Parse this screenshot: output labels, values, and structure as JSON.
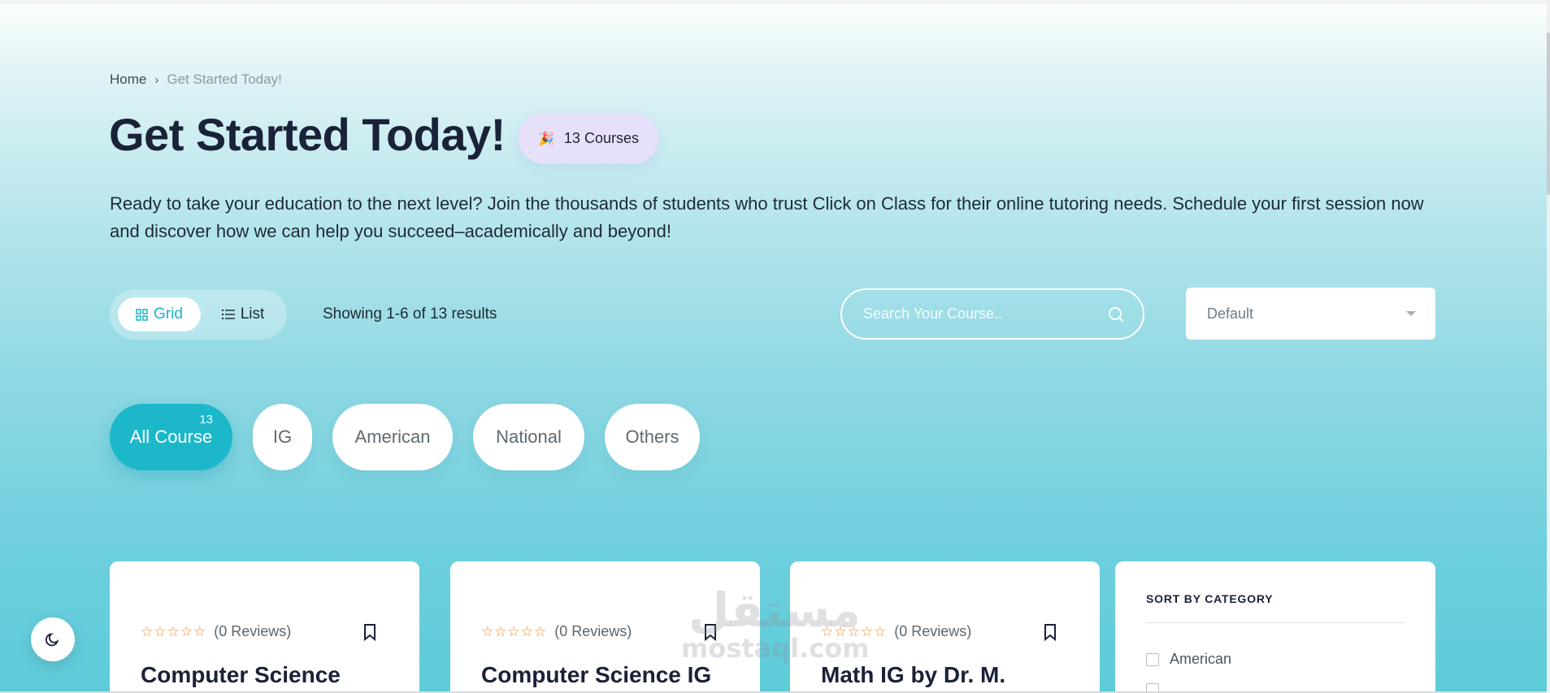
{
  "breadcrumb": {
    "home": "Home",
    "separator": "›",
    "current": "Get Started Today!"
  },
  "header": {
    "title": "Get Started Today!",
    "course_count_icon": "party-popper-icon",
    "course_count": "13 Courses",
    "description": "Ready to take your education to the next level? Join the thousands of students who trust Click on Class for their online tutoring needs. Schedule your first session now and discover how we can help you succeed–academically and beyond!"
  },
  "toolbar": {
    "grid_label": "Grid",
    "list_label": "List",
    "active_view": "Grid",
    "results_text": "Showing 1-6 of 13 results",
    "search_placeholder": "Search Your Course..",
    "sort_value": "Default"
  },
  "filters": [
    {
      "label": "All Course",
      "count": "13",
      "active": true
    },
    {
      "label": "IG",
      "active": false
    },
    {
      "label": "American",
      "active": false
    },
    {
      "label": "National",
      "active": false
    },
    {
      "label": "Others",
      "active": false
    }
  ],
  "courses": [
    {
      "title": "Computer Science",
      "reviews": "(0 Reviews)",
      "stars": 0
    },
    {
      "title": "Computer Science IG",
      "reviews": "(0 Reviews)",
      "stars": 0
    },
    {
      "title": "Math IG by Dr. M.",
      "reviews": "(0 Reviews)",
      "stars": 0
    }
  ],
  "sidebar": {
    "title": "SORT BY CATEGORY",
    "categories": [
      "American"
    ]
  },
  "watermark": {
    "arabic": "مستقل",
    "latin": "mostaql.com"
  },
  "colors": {
    "accent": "#1cb8ca",
    "title": "#1a2238",
    "badge_bg": "#e6e0fb",
    "star": "#f28a2e"
  }
}
